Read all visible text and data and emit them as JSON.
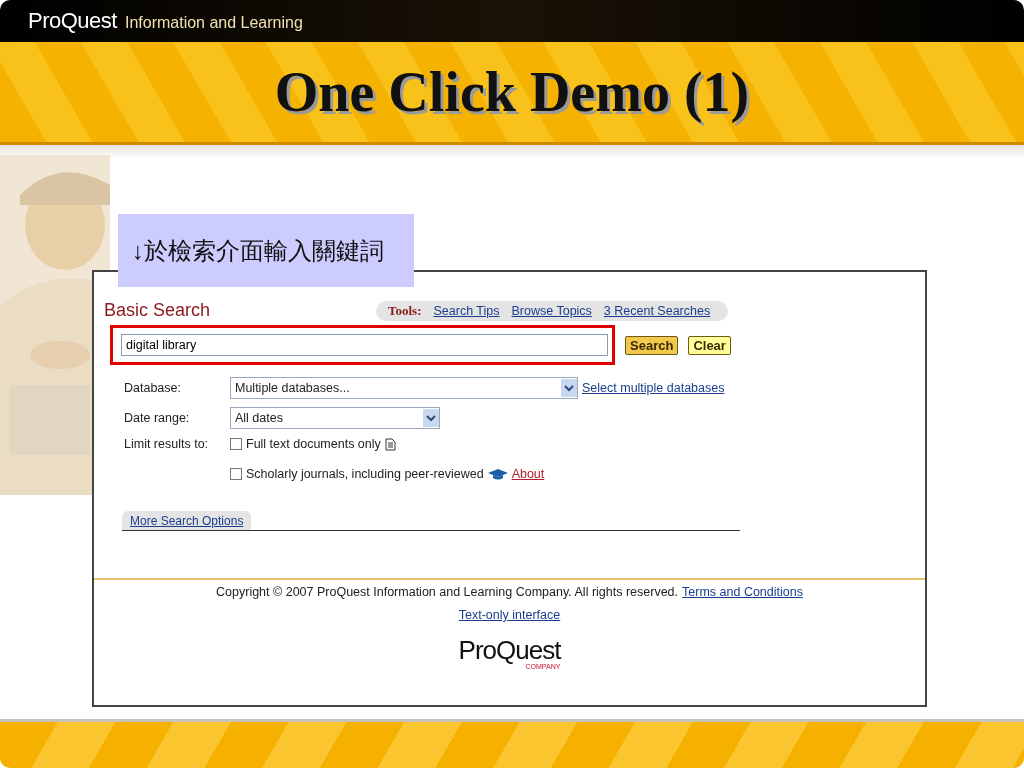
{
  "header": {
    "logo": "ProQuest",
    "tagline": "Information and Learning"
  },
  "slide_title": "One Click Demo (1)",
  "callout": "↓於檢索介面輸入關鍵詞",
  "search_page": {
    "heading": "Basic Search",
    "tools_label": "Tools:",
    "tool_links": [
      "Search Tips",
      "Browse Topics",
      "3 Recent Searches"
    ],
    "search_field": {
      "value": "digital library",
      "highlighted": true
    },
    "buttons": [
      "Search",
      "Clear"
    ],
    "database": {
      "label": "Database:",
      "value": "Multiple databases...",
      "link": "Select multiple databases"
    },
    "date_range": {
      "label": "Date range:",
      "value": "All dates"
    },
    "limit_label": "Limit results to:",
    "limits": [
      {
        "label": "Full text documents only",
        "checked": false,
        "kind": "document"
      },
      {
        "label": "Scholarly journals, including peer-reviewed",
        "checked": false,
        "kind": "cap",
        "link": "About"
      }
    ],
    "more_options_tab": "More Search Options",
    "copyright": "Copyright © 2007 ProQuest Information and Learning Company. All rights reserved.",
    "terms_link": "Terms and Conditions",
    "text_only_link": "Text-only interface",
    "footer_logo": "ProQuest",
    "footer_logo_sub": "COMPANY"
  }
}
